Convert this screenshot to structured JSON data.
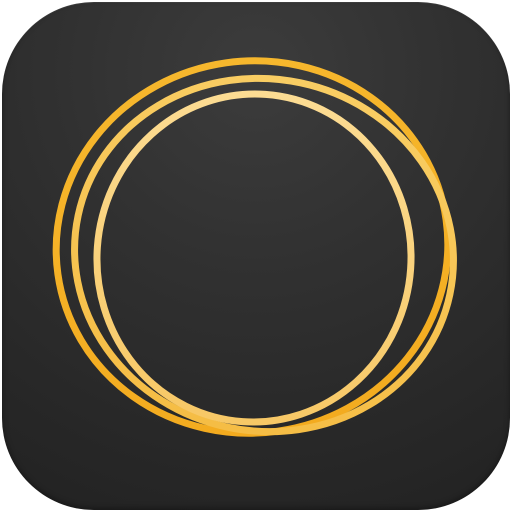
{
  "icon": {
    "name": "rings-app-icon",
    "background_color": "#2c2c2c",
    "ring_colors": [
      "#f5b52e",
      "#f8c654",
      "#fbd98a"
    ]
  }
}
